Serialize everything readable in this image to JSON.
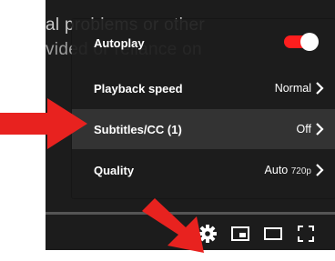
{
  "video": {
    "lines": [
      "",
      "al problems or other",
      "vided or reliance on"
    ]
  },
  "settings": {
    "items": [
      {
        "label": "Autoplay",
        "type": "toggle",
        "on": true
      },
      {
        "label": "Playback speed",
        "value": "Normal"
      },
      {
        "label": "Subtitles/CC (1)",
        "value": "Off",
        "highlighted": true
      },
      {
        "label": "Quality",
        "value": "Auto",
        "value_suffix": "720p"
      }
    ]
  },
  "controls": {
    "icons": [
      "settings-gear-icon",
      "miniplayer-icon",
      "theater-mode-icon",
      "fullscreen-icon"
    ]
  },
  "colors": {
    "accent": "#ff0000",
    "arrow": "#e8221f",
    "menu_bg": "#1c1c1c"
  }
}
